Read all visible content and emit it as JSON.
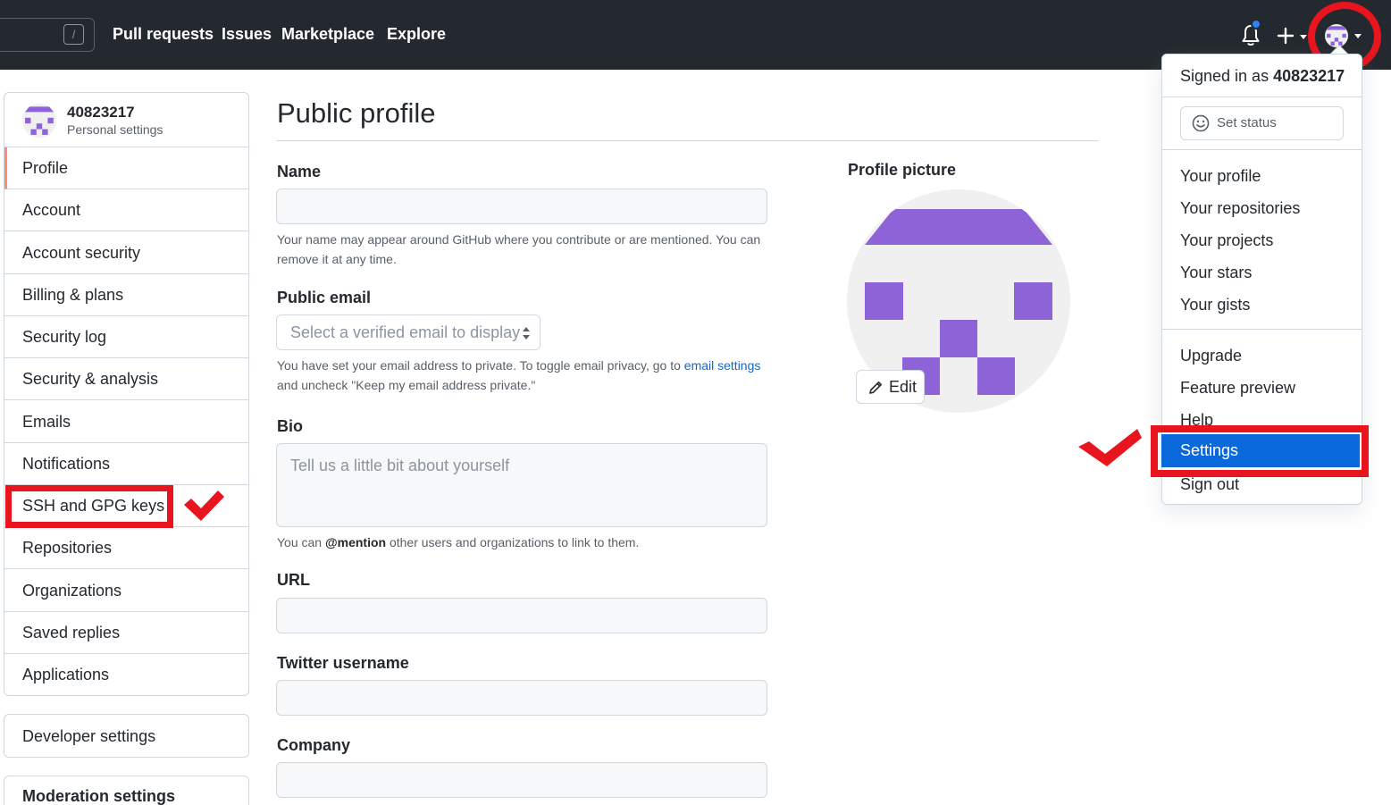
{
  "header": {
    "search_shortcut": "/",
    "nav": [
      "Pull requests",
      "Issues",
      "Marketplace",
      "Explore"
    ]
  },
  "sidebar": {
    "username": "40823217",
    "subtitle": "Personal settings",
    "items": [
      {
        "label": "Profile",
        "active": true
      },
      {
        "label": "Account"
      },
      {
        "label": "Account security"
      },
      {
        "label": "Billing & plans"
      },
      {
        "label": "Security log"
      },
      {
        "label": "Security & analysis"
      },
      {
        "label": "Emails"
      },
      {
        "label": "Notifications"
      },
      {
        "label": "SSH and GPG keys"
      },
      {
        "label": "Repositories"
      },
      {
        "label": "Organizations"
      },
      {
        "label": "Saved replies"
      },
      {
        "label": "Applications"
      }
    ],
    "developer_settings": "Developer settings",
    "moderation_settings": "Moderation settings"
  },
  "main": {
    "title": "Public profile",
    "name": {
      "label": "Name",
      "value": "",
      "note": "Your name may appear around GitHub where you contribute or are mentioned. You can remove it at any time."
    },
    "email": {
      "label": "Public email",
      "select_value": "Select a verified email to display",
      "note_before": "You have set your email address to private. To toggle email privacy, go to",
      "note_link": "email settings",
      "note_after": "and uncheck \"Keep my email address private.\""
    },
    "bio": {
      "label": "Bio",
      "placeholder": "Tell us a little bit about yourself",
      "note_before": "You can",
      "note_mention": "@mention",
      "note_after": "other users and organizations to link to them."
    },
    "url": {
      "label": "URL",
      "value": ""
    },
    "twitter": {
      "label": "Twitter username",
      "value": ""
    },
    "company": {
      "label": "Company",
      "value": ""
    },
    "picture": {
      "label": "Profile picture",
      "edit_label": "Edit"
    }
  },
  "dropdown": {
    "signed_in_prefix": "Signed in as",
    "signed_in_user": "40823217",
    "set_status": "Set status",
    "group1": [
      "Your profile",
      "Your repositories",
      "Your projects",
      "Your stars",
      "Your gists"
    ],
    "group2": [
      "Upgrade",
      "Feature preview",
      "Help"
    ],
    "settings": "Settings",
    "sign_out": "Sign out"
  },
  "colors": {
    "header_bg": "#24292f",
    "identicon": "#8f63d8",
    "highlight": "#e8141e",
    "selected": "#0969da",
    "active_marker": "#fd8c73"
  }
}
